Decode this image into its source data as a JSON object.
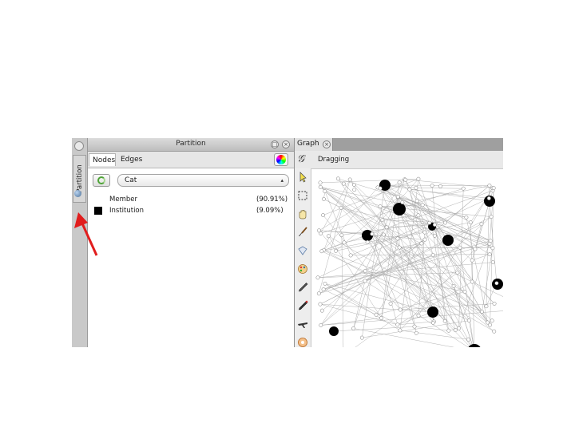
{
  "partition_panel": {
    "title": "Partition",
    "tabs": [
      {
        "label": "Nodes"
      },
      {
        "label": "Edges"
      }
    ],
    "selected_category": "Cat",
    "legend": [
      {
        "label": "Member",
        "percent": "(90.91%)",
        "color": "#ffffff"
      },
      {
        "label": "Institution",
        "percent": "(9.09%)",
        "color": "#000000"
      }
    ]
  },
  "side_strip": {
    "tab_label": "Partition"
  },
  "graph_panel": {
    "tab_label": "Graph",
    "mode_label": "Dragging",
    "tools": [
      "pointer-icon",
      "rectangle-select-icon",
      "drag-hand-icon",
      "painter-brush-icon",
      "size-diamond-icon",
      "label-palette-icon",
      "pencil-icon",
      "edge-pencil-icon",
      "airplane-icon",
      "shortest-path-icon"
    ]
  },
  "colors": {
    "node_member": "#ffffff",
    "node_institution": "#000000",
    "edge": "#a8a8a8",
    "annotation_arrow": "#e11d1d"
  }
}
